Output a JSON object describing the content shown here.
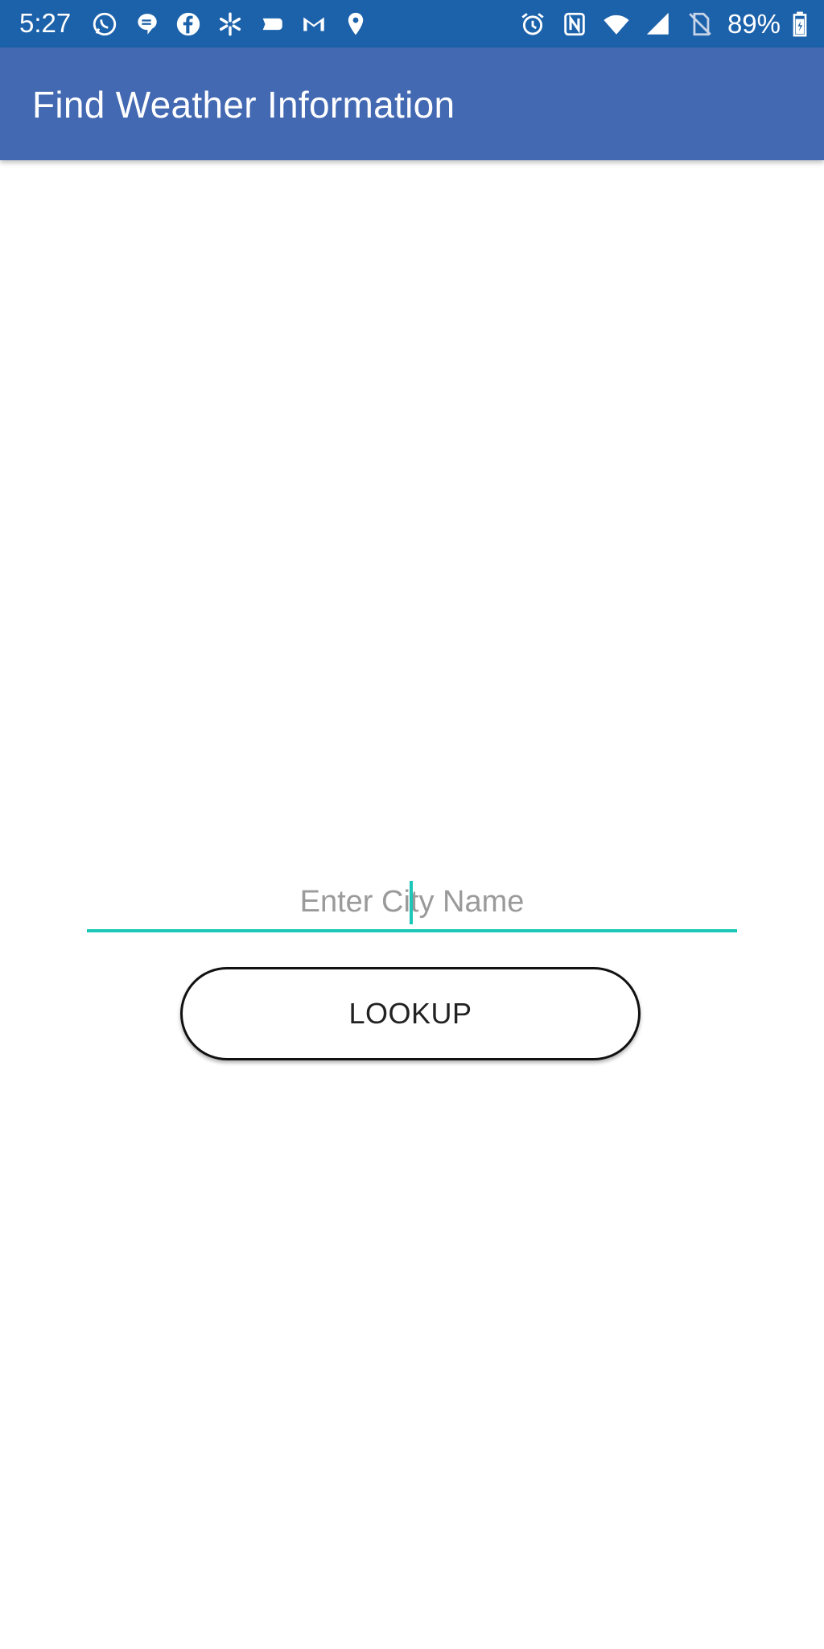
{
  "status_bar": {
    "time": "5:27",
    "battery_percent": "89%",
    "background_color": "#1c62ab",
    "left_icons": [
      "whatsapp-icon",
      "chat-bubble-icon",
      "facebook-icon",
      "walmart-spark-icon",
      "message-tag-icon",
      "gmail-icon",
      "location-pin-icon"
    ],
    "right_icons": [
      "alarm-icon",
      "nfc-icon",
      "wifi-icon",
      "cell-signal-icon",
      "no-sim-icon",
      "battery-icon"
    ]
  },
  "app_bar": {
    "title": "Find Weather Information",
    "background_color": "#4369b2"
  },
  "search": {
    "placeholder": "Enter City Name",
    "value": "",
    "accent_color": "#1cc7b9"
  },
  "actions": {
    "lookup_label": "LOOKUP"
  }
}
